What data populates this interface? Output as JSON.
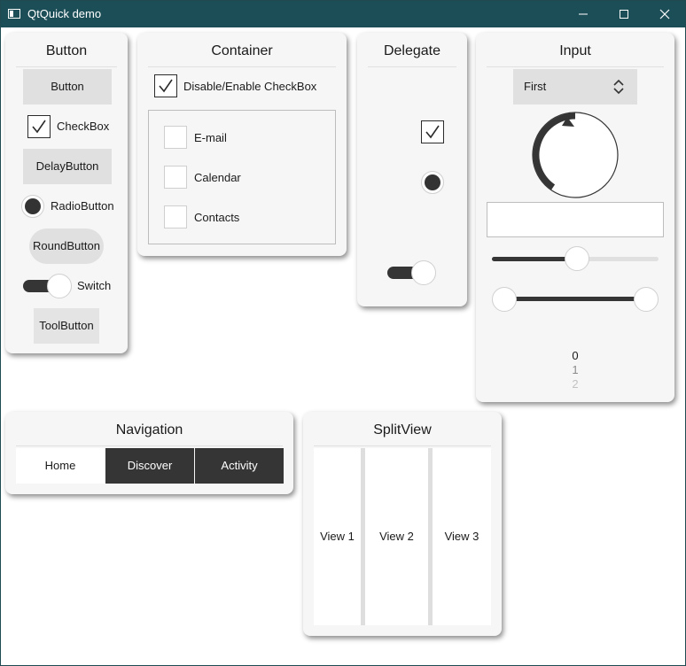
{
  "window": {
    "title": "QtQuick demo",
    "controls": [
      "minimize-icon",
      "maximize-icon",
      "close-icon"
    ]
  },
  "button_pane": {
    "title": "Button",
    "button": "Button",
    "checkbox": "CheckBox",
    "checkbox_checked": true,
    "delay_button": "DelayButton",
    "radio_button": "RadioButton",
    "radio_checked": true,
    "round_button": "RoundButton",
    "switch": "Switch",
    "switch_on": false,
    "tool_button": "ToolButton"
  },
  "container_pane": {
    "title": "Container",
    "master_checkbox": "Disable/Enable CheckBox",
    "master_checked": true,
    "items": [
      {
        "label": "E-mail",
        "checked": false
      },
      {
        "label": "Calendar",
        "checked": false
      },
      {
        "label": "Contacts",
        "checked": false
      }
    ]
  },
  "delegate_pane": {
    "title": "Delegate",
    "check_delegate_checked": true,
    "radio_delegate_checked": true,
    "switch_delegate_on": false
  },
  "input_pane": {
    "title": "Input",
    "combo_value": "First",
    "dial_value": 0.45,
    "text_field_value": "",
    "slider_value": 0.5,
    "range_first": 0.0,
    "range_second": 1.0,
    "tumbler_items": [
      "0",
      "1",
      "2"
    ],
    "tumbler_current": "0"
  },
  "navigation_pane": {
    "title": "Navigation",
    "tabs": [
      "Home",
      "Discover",
      "Activity"
    ],
    "active_tab": "Home"
  },
  "splitview_pane": {
    "title": "SplitView",
    "views": [
      "View 1",
      "View 2",
      "View 3"
    ]
  },
  "colors": {
    "titlebar": "#1c4e58",
    "accent_dark": "#353535",
    "pane_bg": "#f6f6f6"
  }
}
